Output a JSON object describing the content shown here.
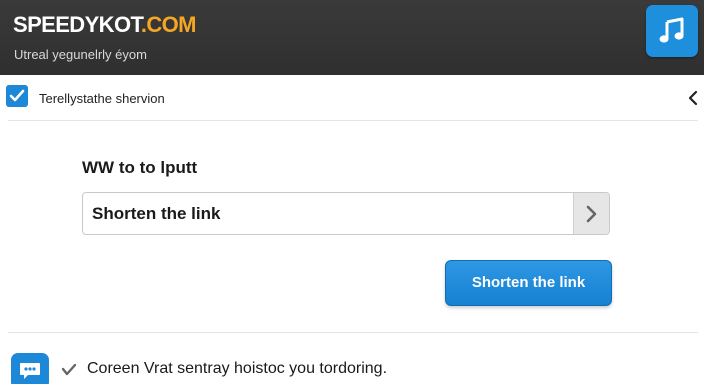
{
  "header": {
    "brand_main": "SPEEDYKOT",
    "brand_accent": ".COM",
    "tagline": "Utreal yegunelrly éyom",
    "app_icon": "music-note-icon"
  },
  "option": {
    "checked": true,
    "label": "Terellystathe shervion",
    "collapse_icon": "chevron-left-icon"
  },
  "form": {
    "heading": "WW to to lputt",
    "input_value": "Shorten the link",
    "go_icon": "chevron-right-icon",
    "submit_label": "Shorten the link"
  },
  "footer": {
    "chat_icon": "chat-bubble-icon",
    "status_text": "Coreen Vrat sentray hoistoc you tordoring."
  },
  "colors": {
    "header_bg": "#333333",
    "brand_accent": "#f5a623",
    "primary_blue": "#1e88d8"
  }
}
